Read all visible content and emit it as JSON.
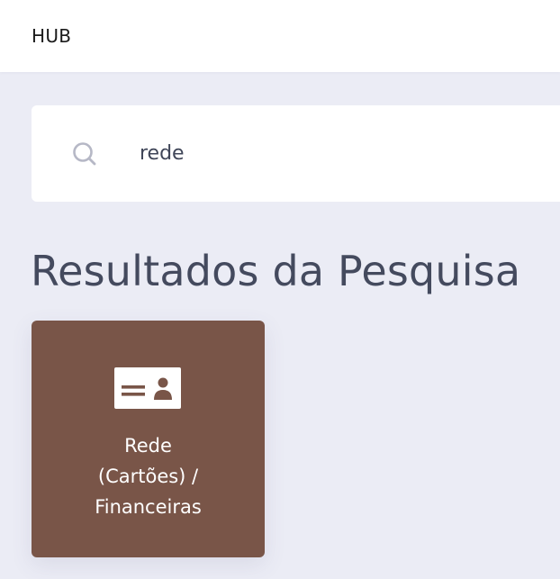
{
  "header": {
    "brand": "HUB"
  },
  "search": {
    "value": "rede",
    "icon": "search-icon"
  },
  "results": {
    "title": "Resultados da Pesquisa",
    "items": [
      {
        "label": "Rede\n(Cartões) /\nFinanceiras",
        "icon": "id-card-icon",
        "color": "#795548"
      }
    ]
  },
  "colors": {
    "background": "#ebecf5",
    "surface": "#ffffff",
    "title_text": "#444a5e",
    "icon_muted": "#b6b8c6"
  }
}
